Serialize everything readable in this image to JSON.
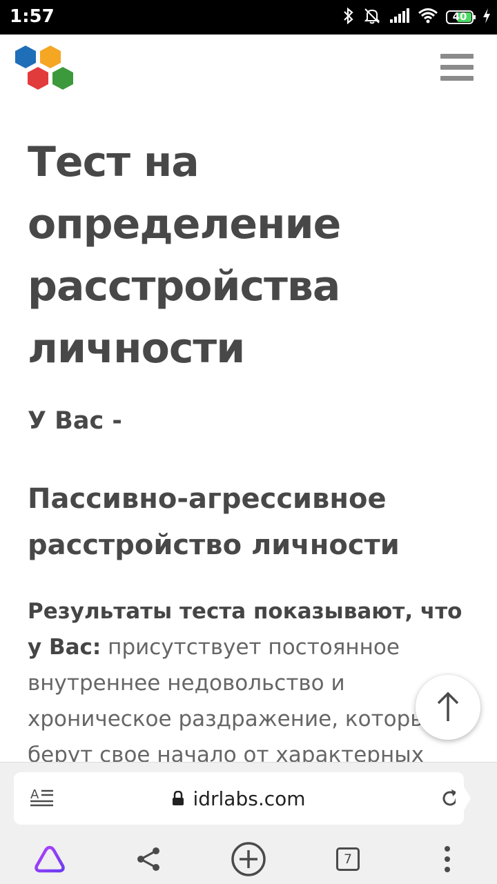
{
  "status_bar": {
    "time": "1:57",
    "battery_level": "40",
    "icons": [
      "bluetooth-icon",
      "mute-bell-icon",
      "signal-icon",
      "wifi-icon",
      "battery-icon",
      "charging-icon"
    ]
  },
  "header": {
    "logo": "hexagon-logo",
    "menu_icon": "hamburger-menu-icon"
  },
  "article": {
    "title_lines": [
      "Тест на",
      "определение",
      "расстройства",
      "личности"
    ],
    "subheading": "У Вас -",
    "result_title_lines": [
      "Пассивно-агрессивное",
      "расстройство личности"
    ],
    "result_lead": "Результаты теста показывают, что",
    "result_lead_2": "у Вас:",
    "result_text_1": " присутствует постоянное",
    "result_text_2": "внутреннее недовольство и",
    "result_text_3": "хроническое раздражение, которые",
    "result_text_4": "берут свое начало от характерных"
  },
  "browser": {
    "url": "idrlabs.com",
    "tab_count": "7",
    "colors": {
      "assistant": "#8a3ffc",
      "icon": "#4a4a4a"
    }
  }
}
